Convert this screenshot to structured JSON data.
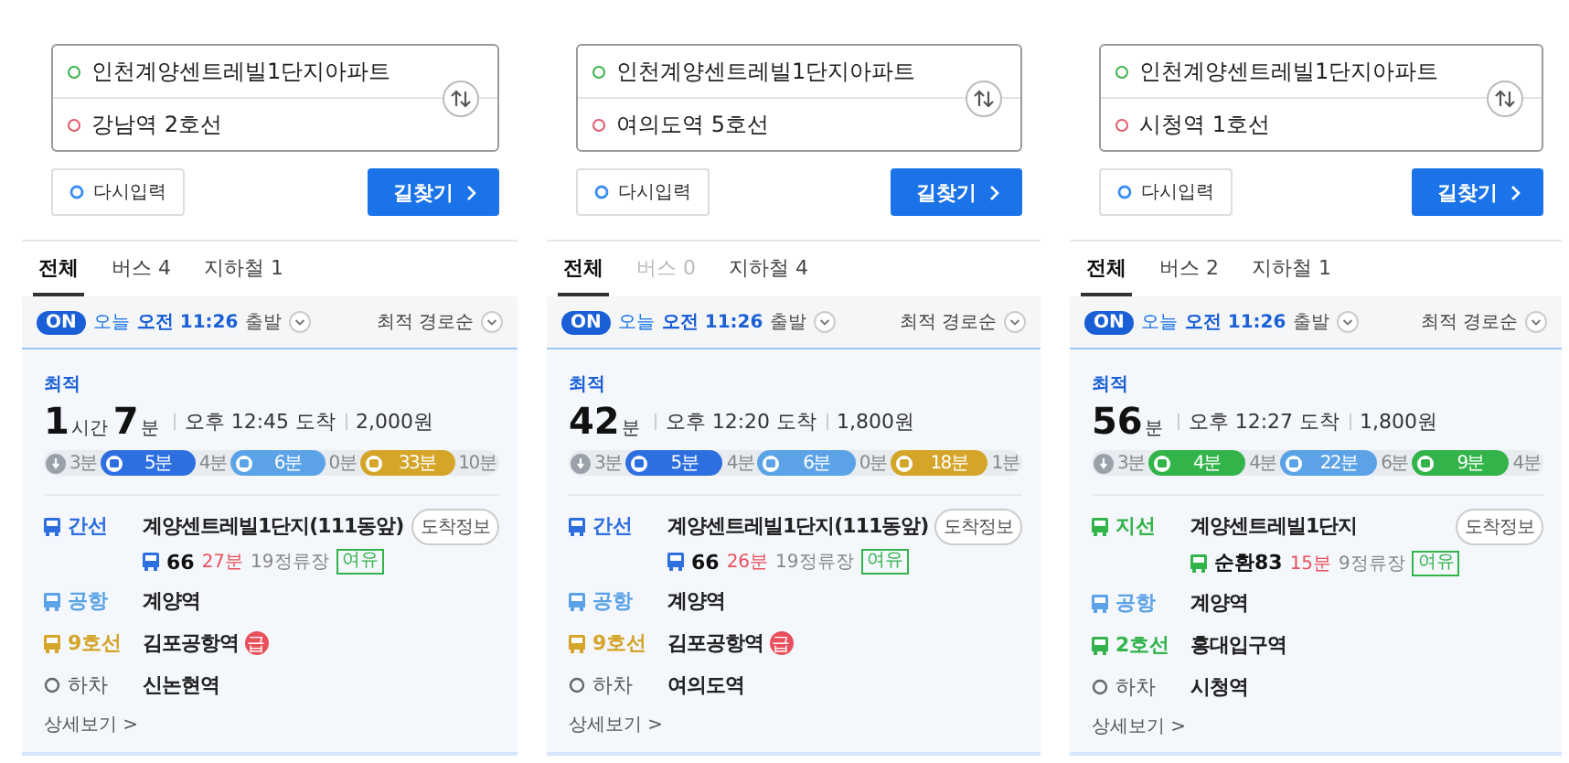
{
  "panels": [
    {
      "origin": "인천계양센트레빌1단지아파트",
      "destination": "강남역 2호선",
      "reset_button": "다시입력",
      "search_button": "길찾기",
      "tabs": [
        {
          "label": "전체",
          "selected": true,
          "disabled": false
        },
        {
          "label": "버스 4",
          "selected": false,
          "disabled": false
        },
        {
          "label": "지하철 1",
          "selected": false,
          "disabled": false
        }
      ],
      "realtime_badge": "ON",
      "departure_day": "오늘",
      "departure_time": "오전 11:26",
      "departure_label": "출발",
      "sort": "최적 경로순",
      "route": {
        "badge": "최적",
        "duration": [
          {
            "num": "1",
            "unit": "시간"
          },
          {
            "num": "7",
            "unit": "분"
          }
        ],
        "arrival": "오후 12:45 도착",
        "fare": "2,000원",
        "segments": [
          {
            "kind": "walk",
            "label": "3분"
          },
          {
            "kind": "ride",
            "label": "5분",
            "color": "#2e6fe0"
          },
          {
            "kind": "gap",
            "label": "4분"
          },
          {
            "kind": "ride",
            "label": "6분",
            "color": "#5ba3e6"
          },
          {
            "kind": "gap",
            "label": "0분"
          },
          {
            "kind": "ride",
            "label": "33분",
            "color": "#d4a528"
          },
          {
            "kind": "gap",
            "label": "10분"
          }
        ],
        "steps": [
          {
            "kind": "ride",
            "color": "#2e6fe0",
            "line": "간선",
            "stop": "계양센트레빌1단지(111동앞)",
            "button": "도착정보",
            "bus": {
              "number": "66",
              "wait": "27분",
              "stops": "19정류장",
              "crowd": "여유"
            }
          },
          {
            "kind": "ride",
            "color": "#5ba3e6",
            "line": "공항",
            "stop": "계양역"
          },
          {
            "kind": "ride",
            "color": "#d4a528",
            "line": "9호선",
            "stop": "김포공항역",
            "express": "급"
          },
          {
            "kind": "alight",
            "line": "하차",
            "stop": "신논현역"
          }
        ],
        "details_link": "상세보기 >"
      }
    },
    {
      "origin": "인천계양센트레빌1단지아파트",
      "destination": "여의도역 5호선",
      "reset_button": "다시입력",
      "search_button": "길찾기",
      "tabs": [
        {
          "label": "전체",
          "selected": true,
          "disabled": false
        },
        {
          "label": "버스 0",
          "selected": false,
          "disabled": true
        },
        {
          "label": "지하철 4",
          "selected": false,
          "disabled": false
        }
      ],
      "realtime_badge": "ON",
      "departure_day": "오늘",
      "departure_time": "오전 11:26",
      "departure_label": "출발",
      "sort": "최적 경로순",
      "route": {
        "badge": "최적",
        "duration": [
          {
            "num": "42",
            "unit": "분"
          }
        ],
        "arrival": "오후 12:20 도착",
        "fare": "1,800원",
        "segments": [
          {
            "kind": "walk",
            "label": "3분"
          },
          {
            "kind": "ride",
            "label": "5분",
            "color": "#2e6fe0"
          },
          {
            "kind": "gap",
            "label": "4분"
          },
          {
            "kind": "ride",
            "label": "6분",
            "color": "#5ba3e6"
          },
          {
            "kind": "gap",
            "label": "0분"
          },
          {
            "kind": "ride",
            "label": "18분",
            "color": "#d4a528"
          },
          {
            "kind": "gap",
            "label": "1분"
          }
        ],
        "steps": [
          {
            "kind": "ride",
            "color": "#2e6fe0",
            "line": "간선",
            "stop": "계양센트레빌1단지(111동앞)",
            "button": "도착정보",
            "bus": {
              "number": "66",
              "wait": "26분",
              "stops": "19정류장",
              "crowd": "여유"
            }
          },
          {
            "kind": "ride",
            "color": "#5ba3e6",
            "line": "공항",
            "stop": "계양역"
          },
          {
            "kind": "ride",
            "color": "#d4a528",
            "line": "9호선",
            "stop": "김포공항역",
            "express": "급"
          },
          {
            "kind": "alight",
            "line": "하차",
            "stop": "여의도역"
          }
        ],
        "details_link": "상세보기 >"
      }
    },
    {
      "origin": "인천계양센트레빌1단지아파트",
      "destination": "시청역 1호선",
      "reset_button": "다시입력",
      "search_button": "길찾기",
      "tabs": [
        {
          "label": "전체",
          "selected": true,
          "disabled": false
        },
        {
          "label": "버스 2",
          "selected": false,
          "disabled": false
        },
        {
          "label": "지하철 1",
          "selected": false,
          "disabled": false
        }
      ],
      "realtime_badge": "ON",
      "departure_day": "오늘",
      "departure_time": "오전 11:26",
      "departure_label": "출발",
      "sort": "최적 경로순",
      "route": {
        "badge": "최적",
        "duration": [
          {
            "num": "56",
            "unit": "분"
          }
        ],
        "arrival": "오후 12:27 도착",
        "fare": "1,800원",
        "segments": [
          {
            "kind": "walk",
            "label": "3분"
          },
          {
            "kind": "ride",
            "label": "4분",
            "color": "#33b44a"
          },
          {
            "kind": "gap",
            "label": "4분"
          },
          {
            "kind": "ride",
            "label": "22분",
            "color": "#5ba3e6"
          },
          {
            "kind": "gap",
            "label": "6분"
          },
          {
            "kind": "ride",
            "label": "9분",
            "color": "#33b44a"
          },
          {
            "kind": "gap",
            "label": "4분"
          }
        ],
        "steps": [
          {
            "kind": "ride",
            "color": "#33b44a",
            "line": "지선",
            "stop": "계양센트레빌1단지",
            "button": "도착정보",
            "bus": {
              "number": "순환83",
              "wait": "15분",
              "stops": "9정류장",
              "crowd": "여유"
            }
          },
          {
            "kind": "ride",
            "color": "#5ba3e6",
            "line": "공항",
            "stop": "계양역"
          },
          {
            "kind": "ride",
            "color": "#33b44a",
            "line": "2호선",
            "stop": "홍대입구역"
          },
          {
            "kind": "alight",
            "line": "하차",
            "stop": "시청역"
          }
        ],
        "details_link": "상세보기 >"
      }
    }
  ]
}
